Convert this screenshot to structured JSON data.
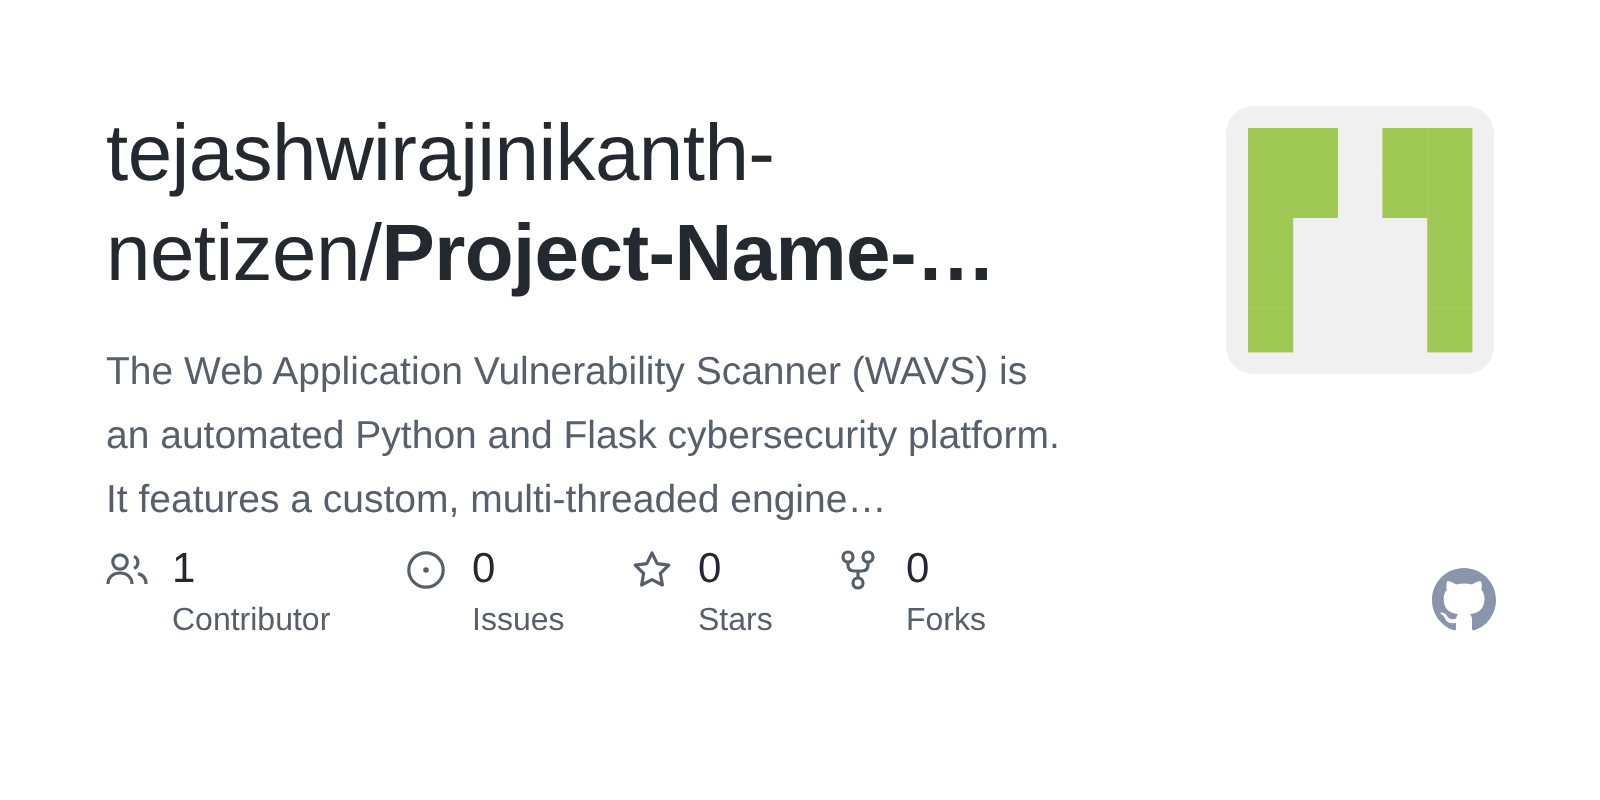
{
  "repo": {
    "title": "tejashwirajinikanth-netizen/**Project-Name-…**",
    "description": "The Web Application Vulnerability Scanner (WAVS) is an automated Python and Flask cybersecurity platform. It features a custom, multi-threaded engine…"
  },
  "stats": [
    {
      "kind": "contributors",
      "count": "1",
      "label": "Contributor"
    },
    {
      "kind": "issues",
      "count": "0",
      "label": "Issues"
    },
    {
      "kind": "stars",
      "count": "0",
      "label": "Stars"
    },
    {
      "kind": "forks",
      "count": "0",
      "label": "Forks"
    }
  ]
}
